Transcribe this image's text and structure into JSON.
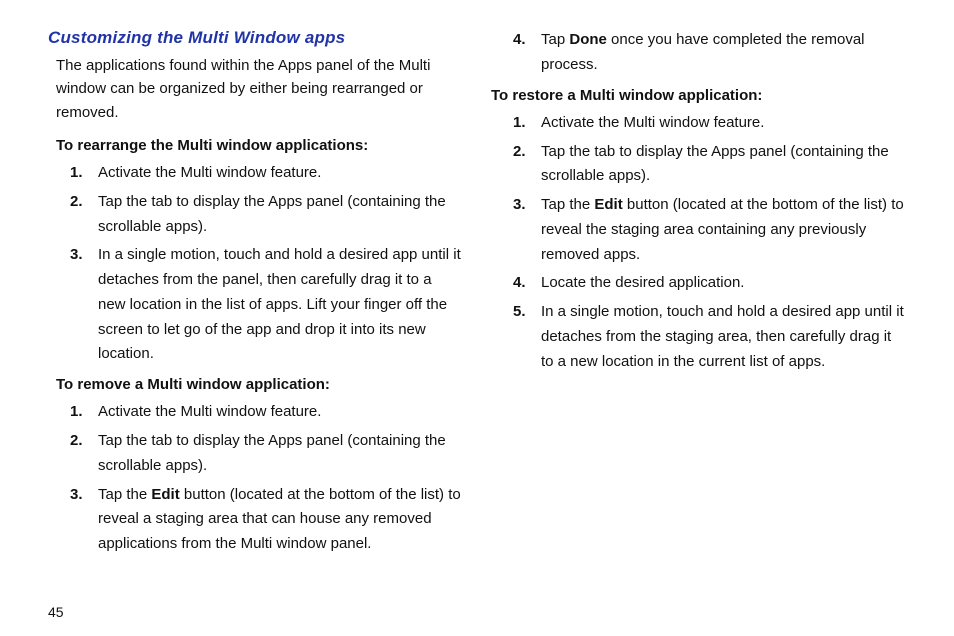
{
  "pageNumber": "45",
  "left": {
    "title": "Customizing the Multi Window apps",
    "intro": "The applications found within the Apps panel of the Multi window can be organized by either being rearranged or removed.",
    "sub1": "To rearrange the Multi window applications:",
    "rearrange": [
      "Activate the Multi window feature.",
      "Tap the tab to display the Apps panel (containing the scrollable apps).",
      "In a single motion, touch and hold a desired app until it detaches from the panel, then carefully drag it to a new location in the list of apps. Lift your finger off the screen to let go of the app and drop it into its new location."
    ],
    "sub2": "To remove a Multi window application:",
    "remove": {
      "s1": "Activate the Multi window feature.",
      "s2": "Tap the tab to display the Apps panel (containing the scrollable apps).",
      "s3_a": "Tap the ",
      "s3_bold": "Edit",
      "s3_b": " button (located at the bottom of the list) to reveal a staging area that can house any removed applications from the Multi window panel."
    }
  },
  "right": {
    "remove4_a": "Tap ",
    "remove4_bold": "Done",
    "remove4_b": " once you have completed the removal process.",
    "sub3": "To restore a Multi window application:",
    "restore": {
      "s1": "Activate the Multi window feature.",
      "s2": "Tap the tab to display the Apps panel (containing the scrollable apps).",
      "s3_a": "Tap the ",
      "s3_bold": "Edit",
      "s3_b": " button (located at the bottom of the list) to reveal the staging area containing any previously removed apps.",
      "s4": "Locate the desired application.",
      "s5": "In a single motion, touch and hold a desired app until it detaches from the staging area, then carefully drag it to a new location in the current list of apps."
    }
  }
}
